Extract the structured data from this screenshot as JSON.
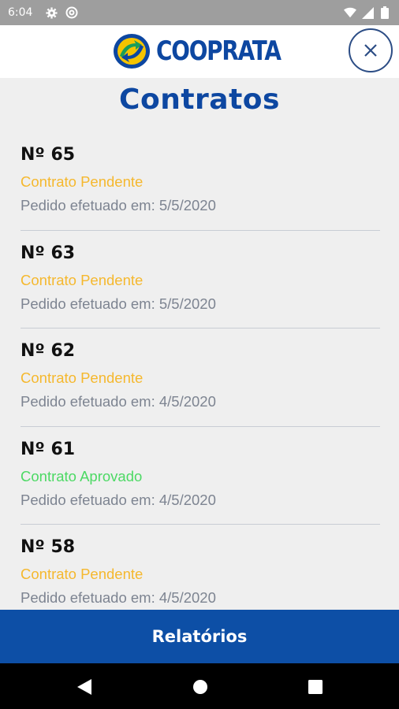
{
  "status_bar": {
    "time": "6:04",
    "icons": [
      "gear-icon",
      "at-icon",
      "wifi-icon",
      "signal-icon",
      "battery-icon"
    ]
  },
  "header": {
    "brand": "COOPRATA",
    "close_icon": "close-icon"
  },
  "page": {
    "title": "Contratos"
  },
  "colors": {
    "brand_blue": "#0d47a1",
    "pending": "#f5b82e",
    "approved": "#4cd964",
    "date_gray": "#7d8491"
  },
  "contracts": [
    {
      "number": "Nº 65",
      "status": "Contrato Pendente",
      "status_type": "pending",
      "date": "Pedido efetuado em: 5/5/2020"
    },
    {
      "number": "Nº 63",
      "status": "Contrato Pendente",
      "status_type": "pending",
      "date": "Pedido efetuado em: 5/5/2020"
    },
    {
      "number": "Nº 62",
      "status": "Contrato Pendente",
      "status_type": "pending",
      "date": "Pedido efetuado em: 4/5/2020"
    },
    {
      "number": "Nº 61",
      "status": "Contrato Aprovado",
      "status_type": "approved",
      "date": "Pedido efetuado em: 4/5/2020"
    },
    {
      "number": "Nº 58",
      "status": "Contrato Pendente",
      "status_type": "pending",
      "date": "Pedido efetuado em: 4/5/2020"
    }
  ],
  "footer": {
    "reports_label": "Relatórios"
  },
  "nav": {
    "icons": [
      "back-icon",
      "home-icon",
      "recents-icon"
    ]
  }
}
